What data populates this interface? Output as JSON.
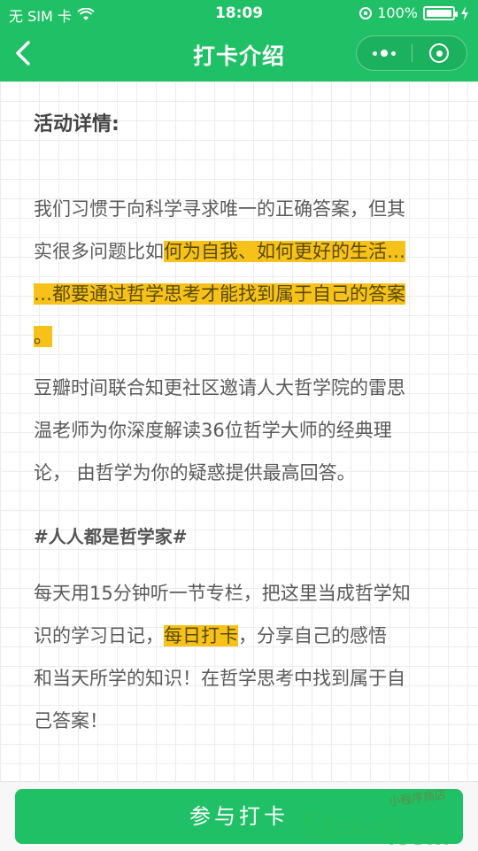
{
  "status_bar": {
    "carrier": "无 SIM 卡",
    "time": "18:09",
    "battery_text": "100%"
  },
  "nav": {
    "title": "打卡介绍"
  },
  "content": {
    "section_title": "活动详情:",
    "para1": {
      "line1": "我们习惯于向科学寻求唯一的正确答案，但其",
      "line2_plain": "实很多问题比如",
      "line2_hl": "何为自我、如何更好的生活…",
      "line3_hl": "…都要通过哲学思考才能找到属于自己的答案",
      "line4_hl": "。"
    },
    "para2": {
      "line1": "豆瓣时间联合知更社区邀请人大哲学院的雷思",
      "line2": "温老师为你深度解读36位哲学大师的经典理",
      "line3": "论，   由哲学为你的疑惑提供最高回答。"
    },
    "hashtag": "#人人都是哲学家#",
    "para3": {
      "line1": "每天用15分钟听一节专栏，把这里当成哲学知",
      "line2_plain_a": "识的学习日记，",
      "line2_hl": "每日打卡",
      "line2_plain_b": "，分享自己的感悟",
      "line3": "和当天所学的知识！在哲学思考中找到属于自",
      "line4": "己答案！"
    }
  },
  "footer": {
    "join_label": "参与打卡"
  },
  "watermark": {
    "main": "51uud.com",
    "sub": "小程序商店"
  },
  "colors": {
    "brand_green": "#1fc066",
    "highlight_yellow": "#f6c21a"
  }
}
